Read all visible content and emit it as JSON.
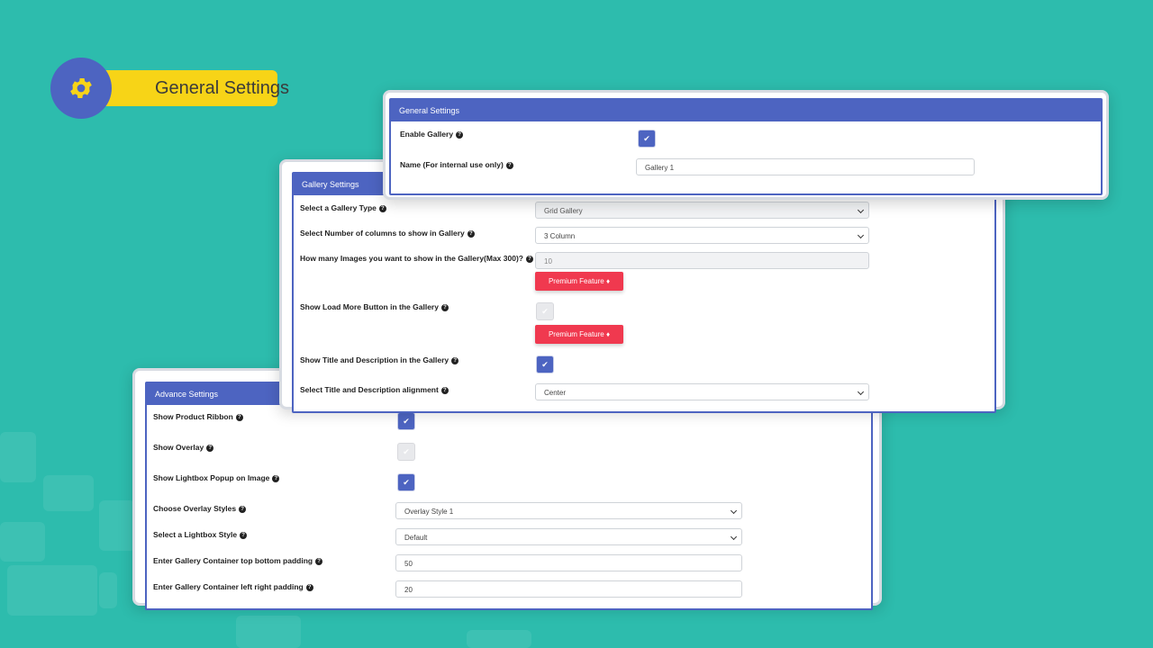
{
  "header": {
    "title": "General Settings",
    "icon": "gear-icon"
  },
  "general_panel": {
    "title": "General Settings",
    "enable_gallery_label": "Enable Gallery",
    "enable_gallery_checked": true,
    "name_label": "Name (For internal use only)",
    "name_value": "Gallery 1"
  },
  "gallery_panel": {
    "title": "Gallery Settings",
    "gallery_type_label": "Select a Gallery Type",
    "gallery_type_value": "Grid Gallery",
    "columns_label": "Select Number of columns to show in Gallery",
    "columns_value": "3 Column",
    "images_label": "How many Images you want to show in the Gallery(Max 300)?",
    "images_value": "10",
    "premium_label": "Premium Feature",
    "load_more_label": "Show Load More Button in the Gallery",
    "load_more_checked": false,
    "title_desc_label": "Show Title and Description in the Gallery",
    "title_desc_checked": true,
    "alignment_label": "Select Title and Description alignment",
    "alignment_value": "Center"
  },
  "advance_panel": {
    "title": "Advance Settings",
    "ribbon_label": "Show Product Ribbon",
    "ribbon_checked": true,
    "overlay_label": "Show Overlay",
    "overlay_checked": false,
    "lightbox_popup_label": "Show Lightbox Popup on Image",
    "lightbox_popup_checked": true,
    "overlay_style_label": "Choose Overlay Styles",
    "overlay_style_value": "Overlay Style 1",
    "lightbox_style_label": "Select a Lightbox Style",
    "lightbox_style_value": "Default",
    "tb_padding_label": "Enter Gallery Container top bottom padding",
    "tb_padding_value": "50",
    "lr_padding_label": "Enter Gallery Container left right padding",
    "lr_padding_value": "20"
  },
  "colors": {
    "background": "#2dbcad",
    "accent": "#4d64c1",
    "premium": "#f0394f",
    "header_pill": "#f7d417"
  }
}
